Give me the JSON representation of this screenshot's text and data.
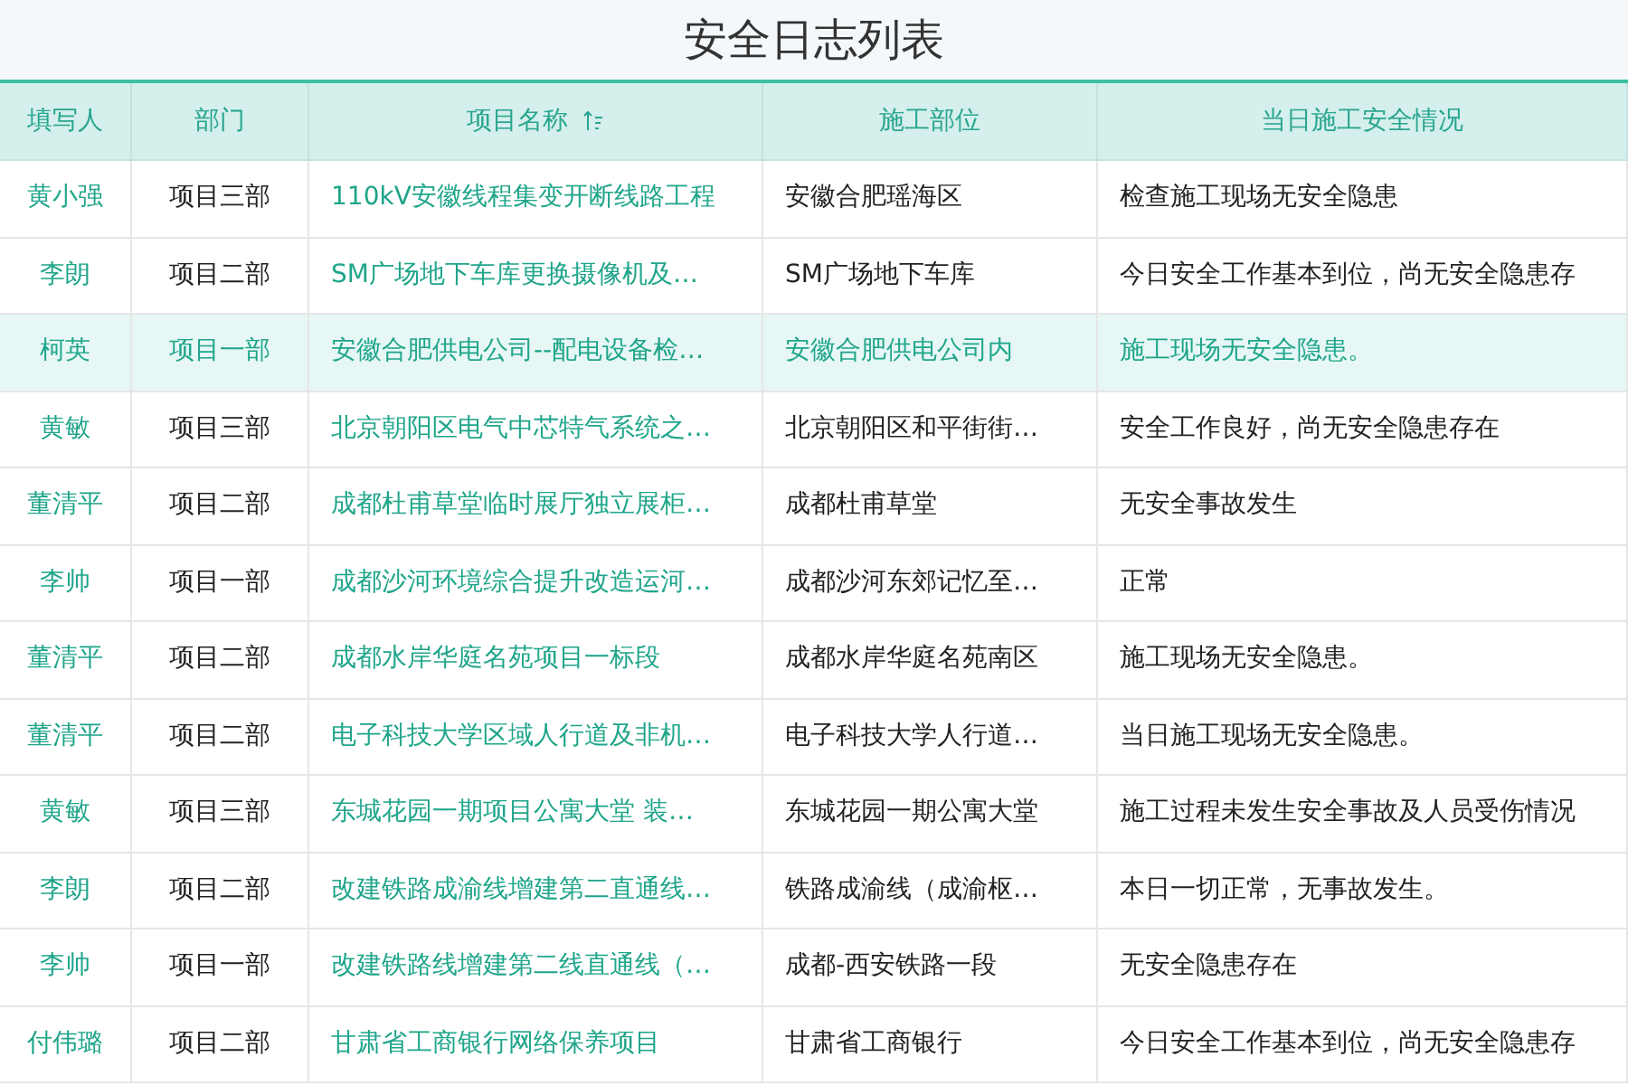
{
  "title": "安全日志列表",
  "table": {
    "columns": [
      {
        "label": "填写人",
        "sortable": false
      },
      {
        "label": "部门",
        "sortable": false
      },
      {
        "label": "项目名称",
        "sortable": true
      },
      {
        "label": "施工部位",
        "sortable": false
      },
      {
        "label": "当日施工安全情况",
        "sortable": false
      }
    ],
    "rows": [
      {
        "selected": false,
        "cells": [
          "黄小强",
          "项目三部",
          "110kV安徽线程集变开断线路工程",
          "安徽合肥瑶海区",
          "检查施工现场无安全隐患"
        ]
      },
      {
        "selected": false,
        "cells": [
          "李朗",
          "项目二部",
          "SM广场地下车库更换摄像机及…",
          "SM广场地下车库",
          "今日安全工作基本到位，尚无安全隐患存"
        ]
      },
      {
        "selected": true,
        "cells": [
          "柯英",
          "项目一部",
          "安徽合肥供电公司--配电设备检…",
          "安徽合肥供电公司内",
          "施工现场无安全隐患。"
        ]
      },
      {
        "selected": false,
        "cells": [
          "黄敏",
          "项目三部",
          "北京朝阳区电气中芯特气系统之…",
          "北京朝阳区和平街街…",
          "安全工作良好，尚无安全隐患存在"
        ]
      },
      {
        "selected": false,
        "cells": [
          "董清平",
          "项目二部",
          "成都杜甫草堂临时展厅独立展柜…",
          "成都杜甫草堂",
          "无安全事故发生"
        ]
      },
      {
        "selected": false,
        "cells": [
          "李帅",
          "项目一部",
          "成都沙河环境综合提升改造运河…",
          "成都沙河东郊记忆至…",
          "正常"
        ]
      },
      {
        "selected": false,
        "cells": [
          "董清平",
          "项目二部",
          "成都水岸华庭名苑项目一标段",
          "成都水岸华庭名苑南区",
          "施工现场无安全隐患。"
        ]
      },
      {
        "selected": false,
        "cells": [
          "董清平",
          "项目二部",
          "电子科技大学区域人行道及非机…",
          "电子科技大学人行道…",
          "当日施工现场无安全隐患。"
        ]
      },
      {
        "selected": false,
        "cells": [
          "黄敏",
          "项目三部",
          "东城花园一期项目公寓大堂 装…",
          "东城花园一期公寓大堂",
          "施工过程未发生安全事故及人员受伤情况"
        ]
      },
      {
        "selected": false,
        "cells": [
          "李朗",
          "项目二部",
          "改建铁路成渝线增建第二直通线…",
          "铁路成渝线（成渝枢…",
          "本日一切正常，无事故发生。"
        ]
      },
      {
        "selected": false,
        "cells": [
          "李帅",
          "项目一部",
          "改建铁路线增建第二线直通线（…",
          "成都-西安铁路一段",
          "无安全隐患存在"
        ]
      },
      {
        "selected": false,
        "cells": [
          "付伟璐",
          "项目二部",
          "甘肃省工商银行网络保养项目",
          "甘肃省工商银行",
          "今日安全工作基本到位，尚无安全隐患存"
        ]
      }
    ]
  }
}
